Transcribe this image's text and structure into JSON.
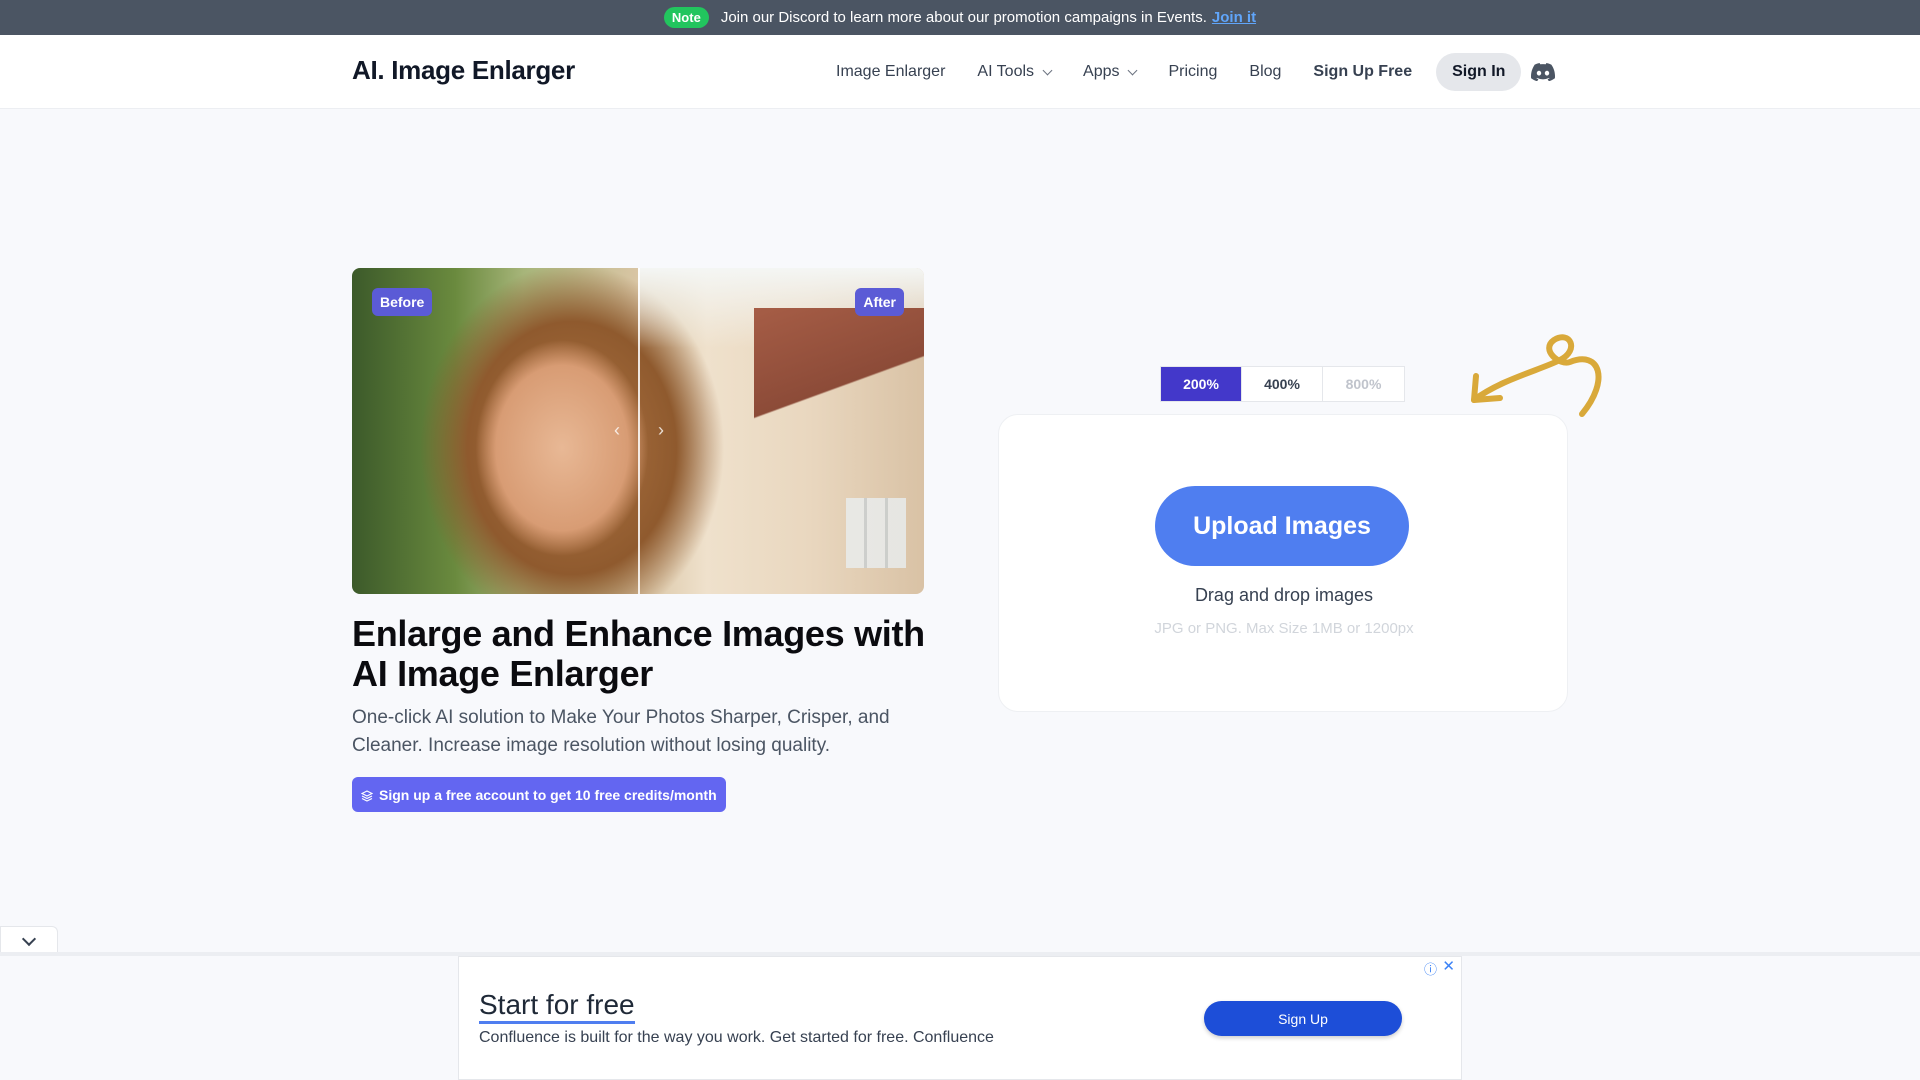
{
  "topbar": {
    "badge": "Note",
    "message": "Join our Discord to learn more about our promotion campaigns in Events.",
    "link": "Join it"
  },
  "header": {
    "logo": "AI. Image Enlarger",
    "nav": {
      "image_enlarger": "Image Enlarger",
      "ai_tools": "AI Tools",
      "apps": "Apps",
      "pricing": "Pricing",
      "blog": "Blog",
      "sign_up": "Sign Up Free",
      "sign_in": "Sign In"
    }
  },
  "compare": {
    "before_label": "Before",
    "after_label": "After"
  },
  "hero": {
    "headline": "Enlarge and Enhance Images with AI Image Enlarger",
    "subhead": "One-click AI solution to Make Your Photos Sharper, Crisper, and Cleaner. Increase image resolution without losing quality.",
    "credits_button": "Sign up a free account to get 10 free credits/month"
  },
  "scales": {
    "options": [
      "200%",
      "400%",
      "800%"
    ],
    "selected": "200%"
  },
  "upload": {
    "button": "Upload Images",
    "drag_text": "Drag and drop images",
    "hint": "JPG or PNG. Max Size 1MB or 1200px"
  },
  "ad": {
    "title": "Start for free",
    "description": "Confluence is built for the way you work. Get started for free. Confluence",
    "button": "Sign Up"
  },
  "colors": {
    "accent": "#4f7ef0",
    "brand_purple": "#6366f1",
    "scale_active": "#4338ca",
    "note_badge": "#22c55e",
    "topbar_bg": "#4b5563"
  }
}
